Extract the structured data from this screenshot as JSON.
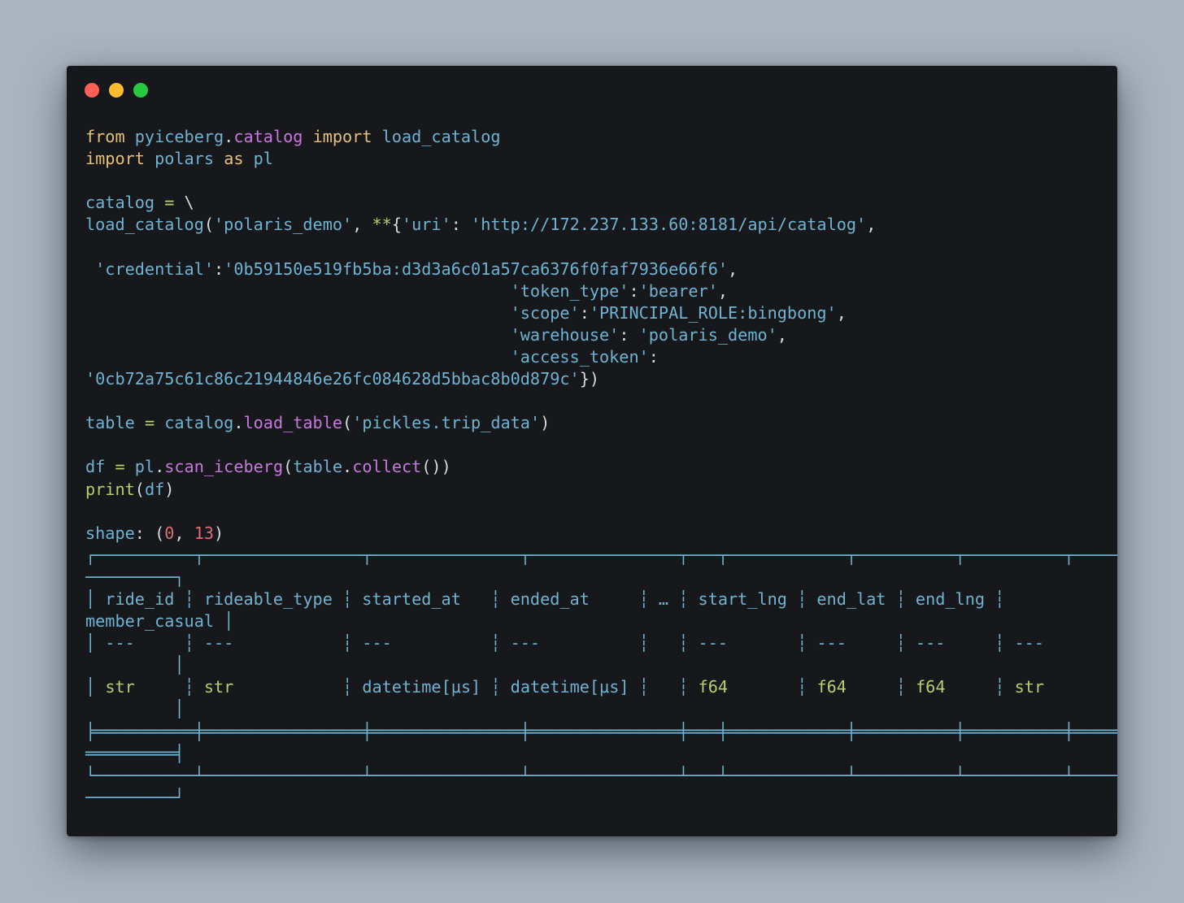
{
  "window": {
    "traffic_lights": {
      "close_color": "#fe5f57",
      "minimize_color": "#febc2e",
      "maximize_color": "#28c840"
    }
  },
  "code": {
    "l1": {
      "a": "from",
      "b": " ",
      "c": "pyiceberg",
      "d": ".",
      "e": "catalog",
      "f": " ",
      "g": "import",
      "h": " ",
      "i": "load_catalog"
    },
    "l2": {
      "a": "import",
      "b": " ",
      "c": "polars",
      "d": " ",
      "e": "as",
      "f": " ",
      "g": "pl"
    },
    "l4": {
      "a": "catalog",
      "b": " ",
      "c": "=",
      "d": " \\"
    },
    "l5": {
      "a": "load_catalog",
      "b": "(",
      "c": "'polaris_demo'",
      "d": ", ",
      "e": "**",
      "f": "{",
      "g": "'uri'",
      "h": ": ",
      "i": "'http://172.237.133.60:8181/api/catalog'",
      "j": ","
    },
    "l7": {
      "a": " 'credential'",
      "b": ":",
      "c": "'0b59150e519fb5ba:d3d3a6c01a57ca6376f0faf7936e66f6'",
      "d": ","
    },
    "l8": {
      "a": "                                           'token_type'",
      "b": ":",
      "c": "'bearer'",
      "d": ","
    },
    "l9": {
      "a": "                                           'scope'",
      "b": ":",
      "c": "'PRINCIPAL_ROLE:bingbong'",
      "d": ","
    },
    "l10": {
      "a": "                                           'warehouse'",
      "b": ": ",
      "c": "'polaris_demo'",
      "d": ","
    },
    "l11": {
      "a": "                                           'access_token'",
      "b": ":"
    },
    "l12": {
      "a": "'0cb72a75c61c86c21944846e26fc084628d5bbac8b0d879c'",
      "b": "})"
    },
    "l14": {
      "a": "table",
      "b": " ",
      "c": "=",
      "d": " catalog",
      "e": ".",
      "f": "load_table",
      "g": "(",
      "h": "'pickles.trip_data'",
      "i": ")"
    },
    "l16": {
      "a": "df",
      "b": " ",
      "c": "=",
      "d": " pl",
      "e": ".",
      "f": "scan_iceberg",
      "g": "(",
      "h": "table",
      "i": ".",
      "j": "collect",
      "k": "())"
    },
    "l17": {
      "a": "print",
      "b": "(",
      "c": "df",
      "d": ")"
    }
  },
  "output": {
    "shape_label": "shape",
    "shape_colon": ": (",
    "rows": "0",
    "sep": ", ",
    "cols": "13",
    "close": ")",
    "box_top_1": "┌──────────┬────────────────┬───────────────┬───────────────┬───┬────────────┬──────────┬──────────┬───────────",
    "box_top_2": "─────────┐",
    "header_1": "│ ride_id ┆ rideable_type ┆ started_at   ┆ ended_at     ┆ … ┆ start_lng ┆ end_lat ┆ end_lng ┆",
    "header_2": "member_casual │",
    "dash_1": "│ ---     ┆ ---           ┆ ---          ┆ ---          ┆   ┆ ---       ┆ ---     ┆ ---     ┆ ---",
    "dash_2": "         │",
    "types": {
      "pipe_open": "│ ",
      "t1": "str",
      "s1": "     ┆ ",
      "t2": "str",
      "s2": "           ┆ ",
      "t3": "datetime[μs]",
      "s3": " ┆ ",
      "t4": "datetime[μs]",
      "s4": " ┆   ┆ ",
      "t5": "f64",
      "s5": "       ┆ ",
      "t6": "f64",
      "s6": "     ┆ ",
      "t7": "f64",
      "s7": "     ┆ ",
      "t8": "str"
    },
    "types_2": "         │",
    "box_mid_1": "╞══════════╪════════════════╪═══════════════╪═══════════════╪═══╪════════════╪══════════╪══════════╪═══════════",
    "box_mid_2": "═════════╡",
    "box_bot_1": "└──────────┴────────────────┴───────────────┴───────────────┴───┴────────────┴──────────┴──────────┴───────────",
    "box_bot_2": "─────────┘"
  }
}
